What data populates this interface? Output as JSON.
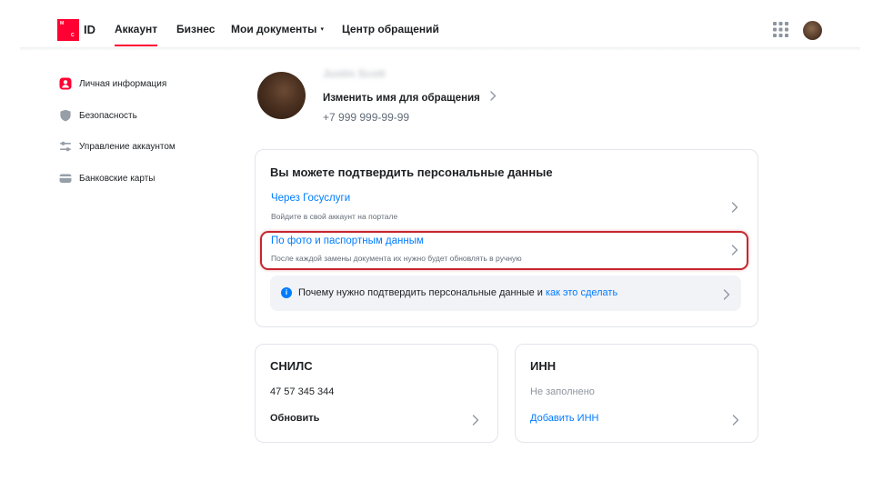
{
  "header": {
    "logo_text": "ID",
    "logo_letters": [
      "М",
      "С"
    ],
    "tabs": [
      {
        "label": "Аккаунт",
        "active": true
      },
      {
        "label": "Бизнес",
        "active": false
      },
      {
        "label": "Мои документы",
        "active": false,
        "has_dropdown": true
      },
      {
        "label": "Центр обращений",
        "active": false
      }
    ],
    "dropdown_caret": "▾",
    "apps_icon": "grid-icon",
    "accent_color": "#ff0032"
  },
  "sidebar": {
    "items": [
      {
        "label": "Личная информация",
        "icon": "user-icon",
        "active": true
      },
      {
        "label": "Безопасность",
        "icon": "shield-icon"
      },
      {
        "label": "Управление аккаунтом",
        "icon": "sliders-icon"
      },
      {
        "label": "Банковские карты",
        "icon": "card-icon"
      }
    ]
  },
  "profile": {
    "name": "Justin Scott",
    "change_name_label": "Изменить имя для обращения",
    "phone": "+7 999 999-99-99"
  },
  "verify_card": {
    "title": "Вы можете подтвердить персональные данные",
    "options": [
      {
        "title": "Через Госуслуги",
        "subtitle": "Войдите в свой аккаунт на портале"
      },
      {
        "title": "По фото и паспортным данным",
        "subtitle": "После каждой замены документа их нужно будет обновлять в ручную",
        "highlighted": true
      }
    ],
    "info": {
      "icon": "info-icon",
      "text": "Почему нужно подтвердить персональные данные и",
      "link": "как это сделать"
    },
    "link_color": "#007cff",
    "highlight_color": "#c5262f"
  },
  "snils_card": {
    "title": "СНИЛС",
    "value": "47 57 345 344",
    "action": "Обновить"
  },
  "inn_card": {
    "title": "ИНН",
    "value": "Не заполнено",
    "action": "Добавить ИНН"
  }
}
